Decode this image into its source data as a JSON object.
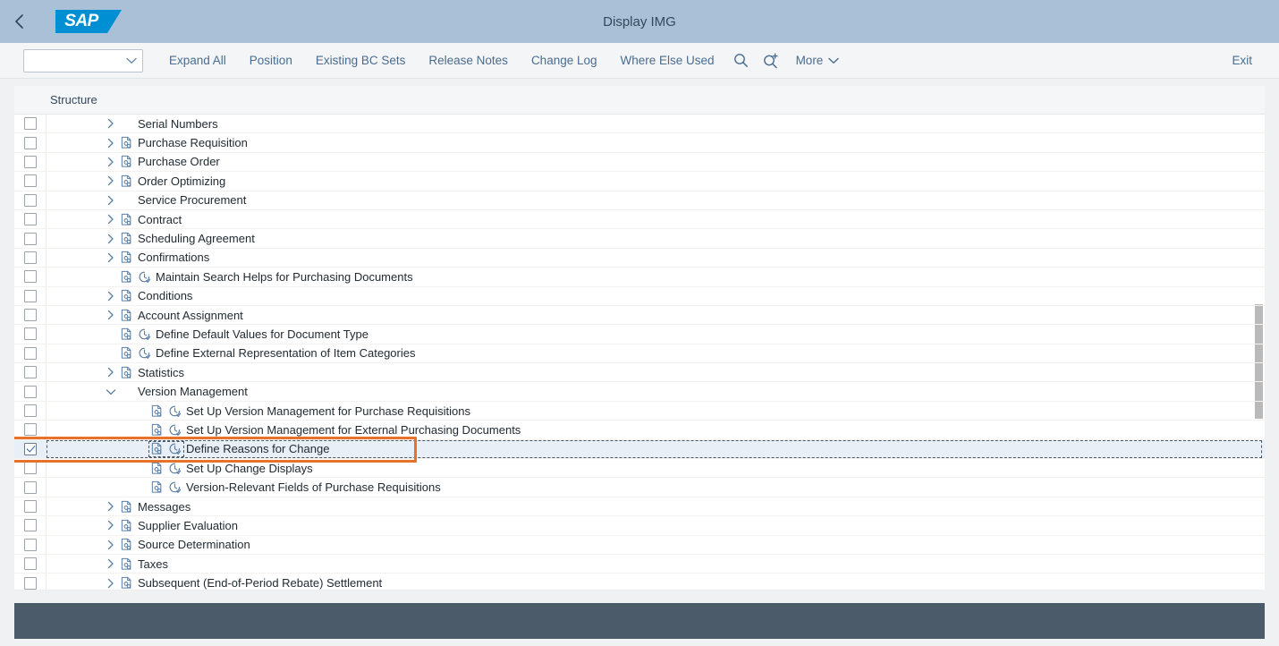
{
  "header": {
    "title": "Display IMG",
    "back_icon": "chevron-left-icon",
    "logo_text": "SAP"
  },
  "toolbar": {
    "select": {
      "value": "",
      "placeholder": "",
      "icon": "chevron-down-icon"
    },
    "buttons": [
      {
        "label": "Expand All",
        "name": "expand-all-button"
      },
      {
        "label": "Position",
        "name": "position-button"
      },
      {
        "label": "Existing BC Sets",
        "name": "existing-bc-sets-button"
      },
      {
        "label": "Release Notes",
        "name": "release-notes-button"
      },
      {
        "label": "Change Log",
        "name": "change-log-button"
      },
      {
        "label": "Where Else Used",
        "name": "where-else-used-button"
      }
    ],
    "search_icon": "search-icon",
    "search_plus_icon": "search-plus-icon",
    "more_label": "More",
    "more_icon": "chevron-down-icon",
    "exit_label": "Exit"
  },
  "table": {
    "column_header": "Structure",
    "rows": [
      {
        "label": "Serial Numbers",
        "level": 1,
        "chevron": "right",
        "doc_icon": false,
        "clock_icon": false,
        "checked": false,
        "selected": false
      },
      {
        "label": "Purchase Requisition",
        "level": 1,
        "chevron": "right",
        "doc_icon": true,
        "clock_icon": false,
        "checked": false,
        "selected": false
      },
      {
        "label": "Purchase Order",
        "level": 1,
        "chevron": "right",
        "doc_icon": true,
        "clock_icon": false,
        "checked": false,
        "selected": false
      },
      {
        "label": "Order Optimizing",
        "level": 1,
        "chevron": "right",
        "doc_icon": true,
        "clock_icon": false,
        "checked": false,
        "selected": false
      },
      {
        "label": "Service Procurement",
        "level": 1,
        "chevron": "right",
        "doc_icon": false,
        "clock_icon": false,
        "checked": false,
        "selected": false
      },
      {
        "label": "Contract",
        "level": 1,
        "chevron": "right",
        "doc_icon": true,
        "clock_icon": false,
        "checked": false,
        "selected": false
      },
      {
        "label": "Scheduling Agreement",
        "level": 1,
        "chevron": "right",
        "doc_icon": true,
        "clock_icon": false,
        "checked": false,
        "selected": false
      },
      {
        "label": "Confirmations",
        "level": 1,
        "chevron": "right",
        "doc_icon": true,
        "clock_icon": false,
        "checked": false,
        "selected": false
      },
      {
        "label": "Maintain Search Helps for Purchasing Documents",
        "level": 1,
        "chevron": "none",
        "doc_icon": true,
        "clock_icon": true,
        "checked": false,
        "selected": false
      },
      {
        "label": "Conditions",
        "level": 1,
        "chevron": "right",
        "doc_icon": true,
        "clock_icon": false,
        "checked": false,
        "selected": false
      },
      {
        "label": "Account Assignment",
        "level": 1,
        "chevron": "right",
        "doc_icon": true,
        "clock_icon": false,
        "checked": false,
        "selected": false
      },
      {
        "label": "Define Default Values for Document Type",
        "level": 1,
        "chevron": "none",
        "doc_icon": true,
        "clock_icon": true,
        "checked": false,
        "selected": false
      },
      {
        "label": "Define External Representation of Item Categories",
        "level": 1,
        "chevron": "none",
        "doc_icon": true,
        "clock_icon": true,
        "checked": false,
        "selected": false
      },
      {
        "label": "Statistics",
        "level": 1,
        "chevron": "right",
        "doc_icon": true,
        "clock_icon": false,
        "checked": false,
        "selected": false
      },
      {
        "label": "Version Management",
        "level": 1,
        "chevron": "down",
        "doc_icon": false,
        "clock_icon": false,
        "checked": false,
        "selected": false
      },
      {
        "label": "Set Up Version Management for Purchase Requisitions",
        "level": 2,
        "chevron": "none",
        "doc_icon": true,
        "clock_icon": true,
        "checked": false,
        "selected": false
      },
      {
        "label": "Set Up Version Management for External Purchasing Documents",
        "level": 2,
        "chevron": "none",
        "doc_icon": true,
        "clock_icon": true,
        "checked": false,
        "selected": false
      },
      {
        "label": "Define Reasons for Change",
        "level": 2,
        "chevron": "none",
        "doc_icon": true,
        "clock_icon": true,
        "checked": true,
        "selected": true
      },
      {
        "label": "Set Up Change Displays",
        "level": 2,
        "chevron": "none",
        "doc_icon": true,
        "clock_icon": true,
        "checked": false,
        "selected": false
      },
      {
        "label": "Version-Relevant Fields of Purchase Requisitions",
        "level": 2,
        "chevron": "none",
        "doc_icon": true,
        "clock_icon": true,
        "checked": false,
        "selected": false
      },
      {
        "label": "Messages",
        "level": 1,
        "chevron": "right",
        "doc_icon": true,
        "clock_icon": false,
        "checked": false,
        "selected": false
      },
      {
        "label": "Supplier Evaluation",
        "level": 1,
        "chevron": "right",
        "doc_icon": true,
        "clock_icon": false,
        "checked": false,
        "selected": false
      },
      {
        "label": "Source Determination",
        "level": 1,
        "chevron": "right",
        "doc_icon": true,
        "clock_icon": false,
        "checked": false,
        "selected": false
      },
      {
        "label": "Taxes",
        "level": 1,
        "chevron": "right",
        "doc_icon": true,
        "clock_icon": false,
        "checked": false,
        "selected": false
      },
      {
        "label": "Subsequent (End-of-Period Rebate) Settlement",
        "level": 1,
        "chevron": "right",
        "doc_icon": true,
        "clock_icon": false,
        "checked": false,
        "selected": false
      }
    ],
    "scrollbar": {
      "thumb_top_pct": 40,
      "thumb_height_pct": 24
    }
  },
  "colors": {
    "header_bg": "#a9c0d6",
    "logo_blue": "#008fd3",
    "link_blue": "#4a6c8f",
    "highlight_orange": "#e8722a",
    "selected_row_bg": "#e8eff7",
    "footer_bg": "#4c5b6a",
    "icon_blue": "#5b7fa6"
  }
}
